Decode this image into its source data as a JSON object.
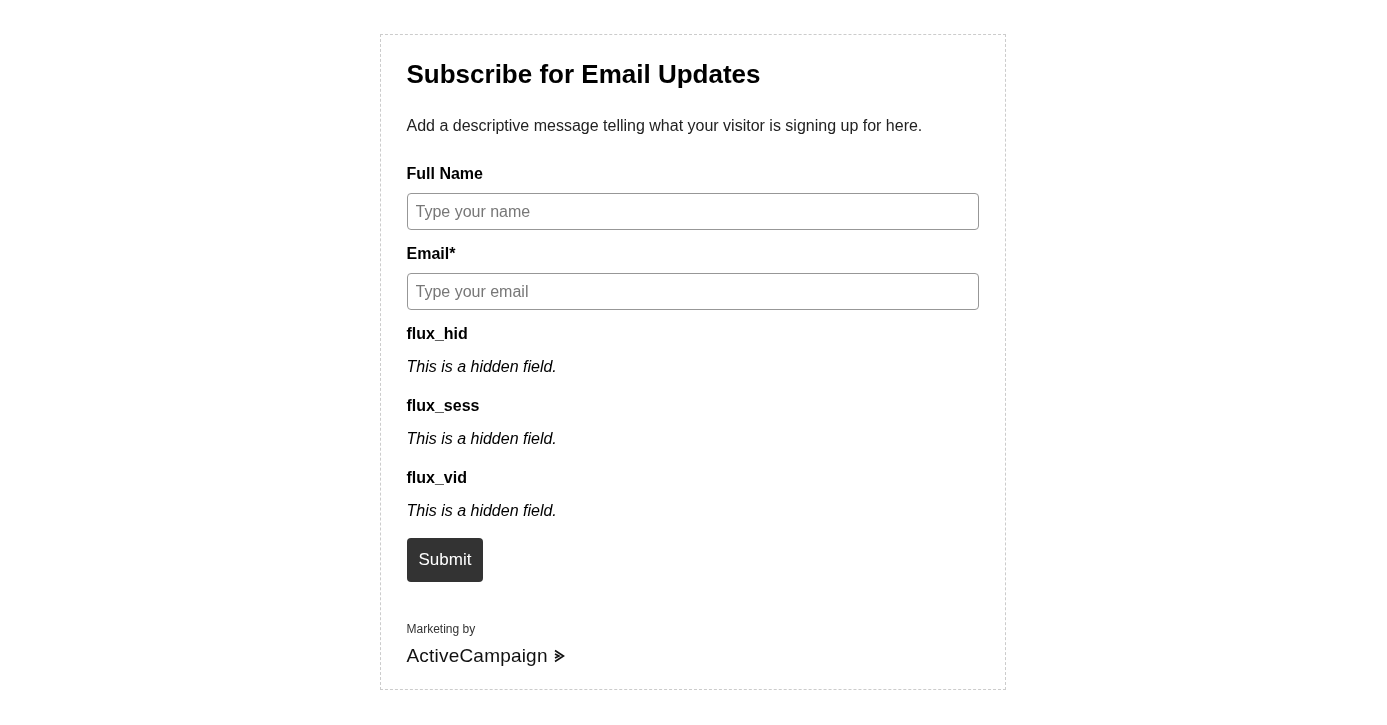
{
  "form": {
    "title": "Subscribe for Email Updates",
    "description": "Add a descriptive message telling what your visitor is signing up for here.",
    "fields": [
      {
        "kind": "input",
        "label": "Full Name",
        "placeholder": "Type your name"
      },
      {
        "kind": "input",
        "label": "Email*",
        "placeholder": "Type your email"
      },
      {
        "kind": "hidden",
        "label": "flux_hid",
        "note": "This is a hidden field."
      },
      {
        "kind": "hidden",
        "label": "flux_sess",
        "note": "This is a hidden field."
      },
      {
        "kind": "hidden",
        "label": "flux_vid",
        "note": "This is a hidden field."
      }
    ],
    "submit": "Submit",
    "footer": {
      "caption": "Marketing by",
      "logo": "ActiveCampaign"
    }
  }
}
